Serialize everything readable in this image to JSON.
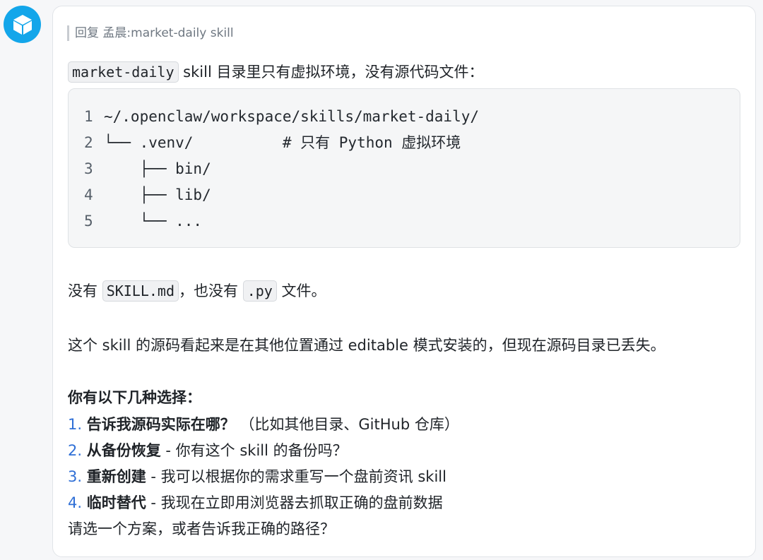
{
  "reply": {
    "prefix": "回复 孟晨",
    "colon": ":",
    "title": "market-daily skill"
  },
  "intro": {
    "code": "market-daily",
    "text": " skill 目录里只有虚拟环境，没有源代码文件："
  },
  "code_block": {
    "lines": [
      {
        "num": "1",
        "text": "~/.openclaw/workspace/skills/market-daily/"
      },
      {
        "num": "2",
        "text": "└── .venv/          # 只有 Python 虚拟环境"
      },
      {
        "num": "3",
        "text": "    ├── bin/"
      },
      {
        "num": "4",
        "text": "    ├── lib/"
      },
      {
        "num": "5",
        "text": "    └── ..."
      }
    ]
  },
  "missing": {
    "t1": "没有 ",
    "c1": "SKILL.md",
    "t2": "，也没有 ",
    "c2": ".py",
    "t3": " 文件。"
  },
  "explain": "这个 skill 的源码看起来是在其他位置通过 editable 模式安装的，但现在源码目录已丢失。",
  "choices_heading": "你有以下几种选择：",
  "options": [
    {
      "num": "1.",
      "bold": "告诉我源码实际在哪？",
      "rest": " （比如其他目录、GitHub 仓库）"
    },
    {
      "num": "2.",
      "bold": "从备份恢复",
      "rest": " - 你有这个 skill 的备份吗？"
    },
    {
      "num": "3.",
      "bold": "重新创建",
      "rest": " - 我可以根据你的需求重写一个盘前资讯 skill"
    },
    {
      "num": "4.",
      "bold": "临时替代",
      "rest": " - 我现在立即用浏览器去抓取正确的盘前数据"
    }
  ],
  "closing": "请选一个方案，或者告诉我正确的路径？",
  "icons": {
    "avatar": "cube-icon"
  },
  "colors": {
    "avatar_bg": "#13a6ea",
    "list_number": "#2f6fd6"
  }
}
